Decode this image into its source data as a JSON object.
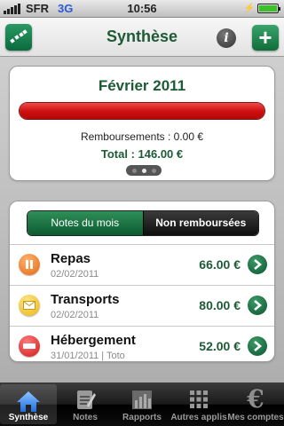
{
  "status_bar": {
    "carrier": "SFR",
    "network": "3G",
    "time": "10:56"
  },
  "nav": {
    "title": "Synthèse",
    "info_label": "i",
    "add_label": "+"
  },
  "summary": {
    "month": "Février 2011",
    "progress_fraction": 1.0,
    "reimbursements": "Remboursements : 0.00 €",
    "total": "Total : 146.00 €",
    "pages": 3,
    "current_page": 2
  },
  "segments": [
    {
      "label": "Notes du mois",
      "active": true
    },
    {
      "label": "Non remboursées",
      "active": false
    }
  ],
  "notes": [
    {
      "title": "Repas",
      "date": "02/02/2011",
      "amount": "66.00 €",
      "status_icon": "pause-icon"
    },
    {
      "title": "Transports",
      "date": "02/02/2011",
      "amount": "80.00 €",
      "status_icon": "envelope-icon"
    },
    {
      "title": "Hébergement",
      "date": "31/01/2011 | Toto",
      "amount": "52.00 €",
      "status_icon": "stop-icon"
    }
  ],
  "tabs": [
    {
      "label": "Synthèse",
      "icon": "home-icon",
      "active": true
    },
    {
      "label": "Notes",
      "icon": "notepad-icon",
      "active": false
    },
    {
      "label": "Rapports",
      "icon": "bar-chart-icon",
      "active": false
    },
    {
      "label": "Autres applis",
      "icon": "grid-icon",
      "active": false
    },
    {
      "label": "Mes comptes",
      "icon": "euro-icon",
      "active": false
    }
  ],
  "colors": {
    "brand_green": "#1d5a36",
    "alert_red": "#d01010"
  }
}
